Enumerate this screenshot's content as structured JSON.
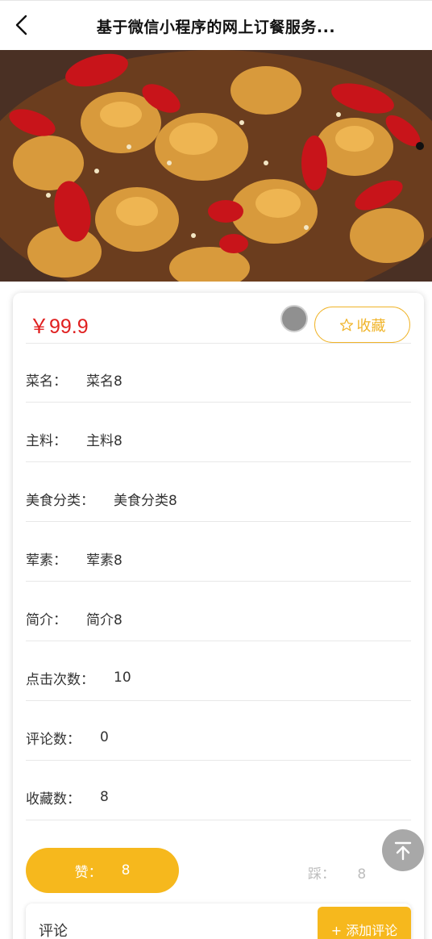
{
  "nav": {
    "title": "基于微信小程序的网上订餐服务..."
  },
  "detail": {
    "price": "￥99.9",
    "favorite_label": "收藏",
    "fields": [
      {
        "label": "菜名：",
        "value": "菜名8"
      },
      {
        "label": "主料：",
        "value": "主料8"
      },
      {
        "label": "美食分类：",
        "value": "美食分类8"
      },
      {
        "label": "荤素：",
        "value": "荤素8"
      },
      {
        "label": "简介：",
        "value": "简介8"
      },
      {
        "label": "点击次数：",
        "value": "10"
      },
      {
        "label": "评论数：",
        "value": "0"
      },
      {
        "label": "收藏数：",
        "value": "8"
      }
    ],
    "like_label": "赞：",
    "like_count": "8",
    "dislike_label": "踩：",
    "dislike_count": "8"
  },
  "comments": {
    "title": "评论",
    "add_label": "+ 添加评论"
  },
  "colors": {
    "accent": "#f6b81d",
    "price": "#e02020"
  }
}
